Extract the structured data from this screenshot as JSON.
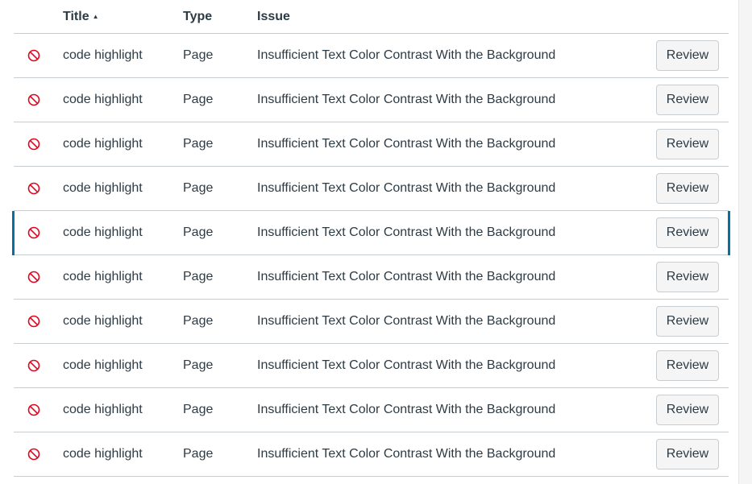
{
  "table": {
    "headers": {
      "title": "Title",
      "type": "Type",
      "issue": "Issue"
    },
    "sort_indicator": "▲",
    "rows": [
      {
        "title": "code highlight",
        "type": "Page",
        "issue": "Insufficient Text Color Contrast With the Background",
        "action": "Review",
        "status_icon": "no-entry-icon"
      },
      {
        "title": "code highlight",
        "type": "Page",
        "issue": "Insufficient Text Color Contrast With the Background",
        "action": "Review",
        "status_icon": "no-entry-icon"
      },
      {
        "title": "code highlight",
        "type": "Page",
        "issue": "Insufficient Text Color Contrast With the Background",
        "action": "Review",
        "status_icon": "no-entry-icon"
      },
      {
        "title": "code highlight",
        "type": "Page",
        "issue": "Insufficient Text Color Contrast With the Background",
        "action": "Review",
        "status_icon": "no-entry-icon"
      },
      {
        "title": "code highlight",
        "type": "Page",
        "issue": "Insufficient Text Color Contrast With the Background",
        "action": "Review",
        "status_icon": "no-entry-icon",
        "selected": true
      },
      {
        "title": "code highlight",
        "type": "Page",
        "issue": "Insufficient Text Color Contrast With the Background",
        "action": "Review",
        "status_icon": "no-entry-icon"
      },
      {
        "title": "code highlight",
        "type": "Page",
        "issue": "Insufficient Text Color Contrast With the Background",
        "action": "Review",
        "status_icon": "no-entry-icon"
      },
      {
        "title": "code highlight",
        "type": "Page",
        "issue": "Insufficient Text Color Contrast With the Background",
        "action": "Review",
        "status_icon": "no-entry-icon"
      },
      {
        "title": "code highlight",
        "type": "Page",
        "issue": "Insufficient Text Color Contrast With the Background",
        "action": "Review",
        "status_icon": "no-entry-icon"
      },
      {
        "title": "code highlight",
        "type": "Page",
        "issue": "Insufficient Text Color Contrast With the Background",
        "action": "Review",
        "status_icon": "no-entry-icon"
      }
    ]
  },
  "colors": {
    "text": "#2d3b45",
    "error_icon": "#e0061f",
    "selected_accent": "#0770a3",
    "border": "#c7cdd1",
    "button_bg": "#f5f5f5"
  }
}
